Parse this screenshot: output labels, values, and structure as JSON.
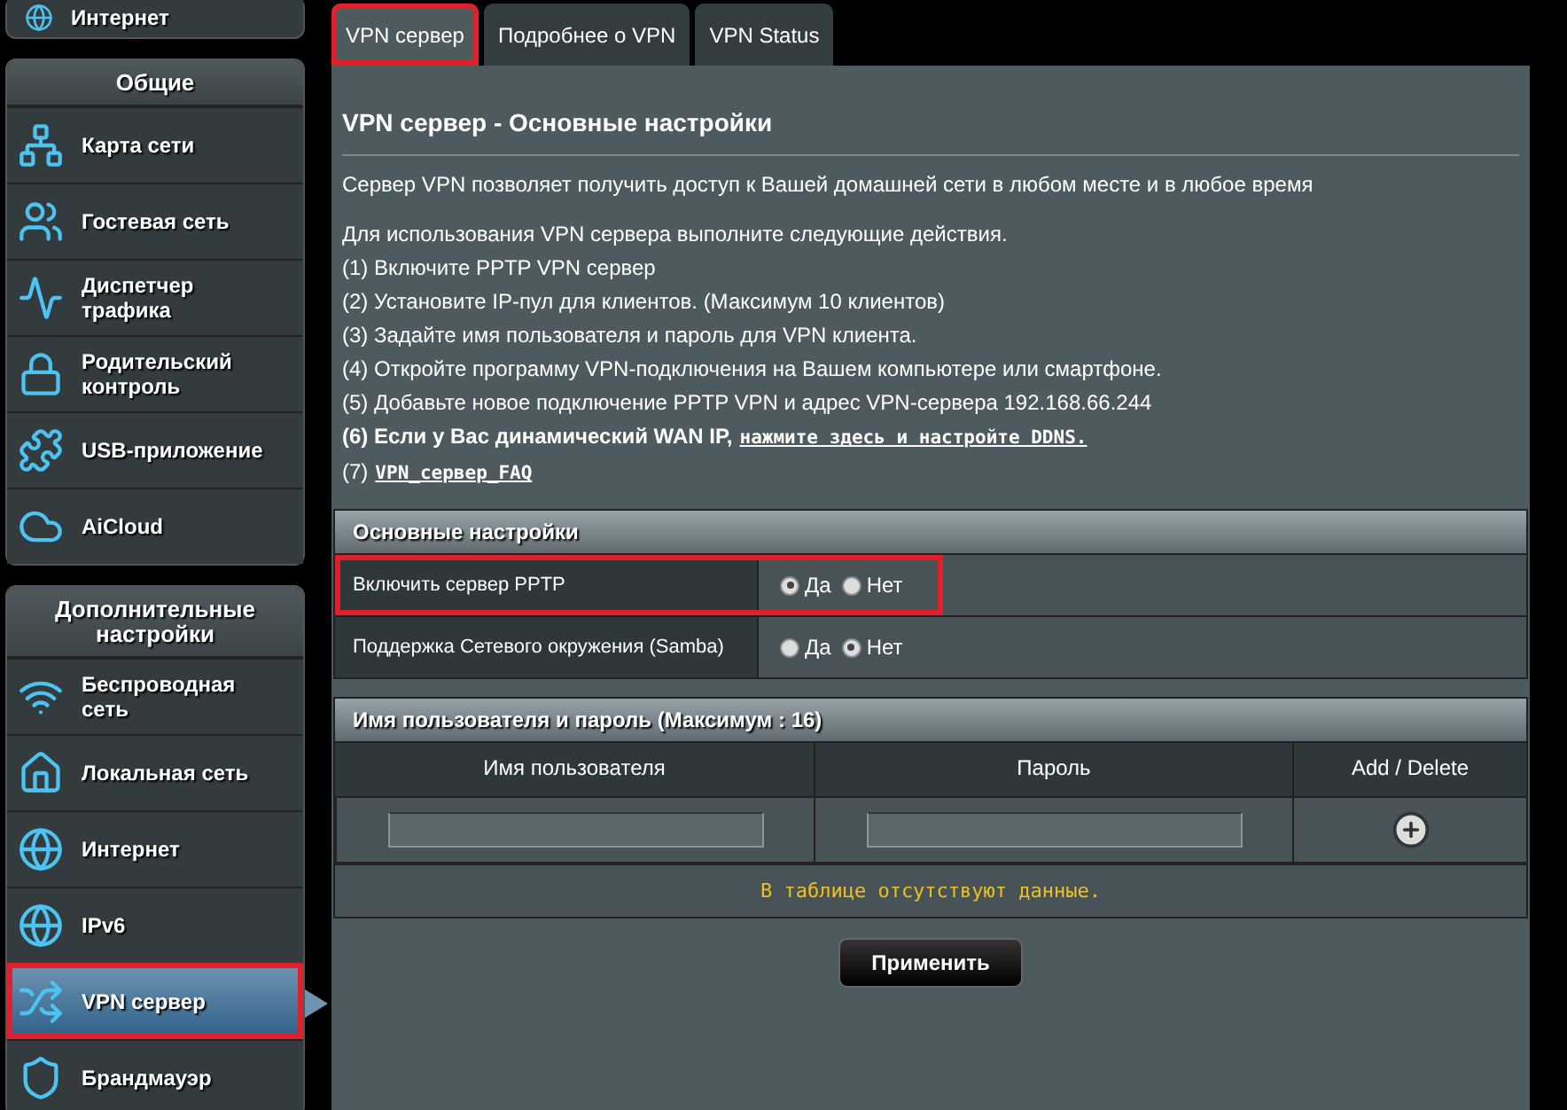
{
  "sidebar": {
    "top_item": {
      "label": "Интернет"
    },
    "groups": [
      {
        "title": "Общие",
        "items": [
          {
            "label": "Карта сети",
            "selected": false,
            "highlighted": false
          },
          {
            "label": "Гостевая сеть",
            "selected": false,
            "highlighted": false
          },
          {
            "label": "Диспетчер трафика",
            "selected": false,
            "highlighted": false
          },
          {
            "label": "Родительский контроль",
            "selected": false,
            "highlighted": false
          },
          {
            "label": "USB-приложение",
            "selected": false,
            "highlighted": false
          },
          {
            "label": "AiCloud",
            "selected": false,
            "highlighted": false
          }
        ]
      },
      {
        "title": "Дополнительные настройки",
        "items": [
          {
            "label": "Беспроводная сеть",
            "selected": false,
            "highlighted": false
          },
          {
            "label": "Локальная сеть",
            "selected": false,
            "highlighted": false
          },
          {
            "label": "Интернет",
            "selected": false,
            "highlighted": false
          },
          {
            "label": "IPv6",
            "selected": false,
            "highlighted": false
          },
          {
            "label": "VPN сервер",
            "selected": true,
            "highlighted": true
          },
          {
            "label": "Брандмауэр",
            "selected": false,
            "highlighted": false
          }
        ]
      }
    ]
  },
  "tabs": [
    {
      "label": "VPN сервер",
      "selected": true,
      "highlighted": true
    },
    {
      "label": "Подробнее о VPN",
      "selected": false,
      "highlighted": false
    },
    {
      "label": "VPN Status",
      "selected": false,
      "highlighted": false
    }
  ],
  "page": {
    "title": "VPN сервер - Основные настройки",
    "intro": "Сервер VPN позволяет получить доступ к Вашей домашней сети в любом месте и в любое время",
    "steps_intro": "Для использования VPN сервера выполните следующие действия.",
    "steps": [
      {
        "text": "(1) Включите PPTP VPN сервер",
        "bold": false
      },
      {
        "text": "(2) Установите IP-пул для клиентов. (Максимум 10 клиентов)",
        "bold": false
      },
      {
        "text": "(3) Задайте имя пользователя и пароль для VPN клиента.",
        "bold": false
      },
      {
        "text": "(4) Откройте программу VPN-подключения на Вашем компьютере или смартфоне.",
        "bold": false
      },
      {
        "text": "(5) Добавьте новое подключение PPTP VPN и адрес VPN-сервера 192.168.66.244",
        "bold": false
      },
      {
        "text": "(6) Если у Вас динамический WAN IP,",
        "bold": true,
        "link": "нажмите здесь и настройте DDNS."
      },
      {
        "text": "(7)",
        "bold": false,
        "link": "VPN_сервер_FAQ"
      }
    ]
  },
  "basic_settings": {
    "title": "Основные настройки",
    "rows": [
      {
        "label": "Включить сервер PPTP",
        "highlighted": true,
        "options": [
          {
            "label": "Да",
            "selected": true
          },
          {
            "label": "Нет",
            "selected": false
          }
        ]
      },
      {
        "label": "Поддержка Сетевого окружения (Samba)",
        "highlighted": false,
        "options": [
          {
            "label": "Да",
            "selected": false
          },
          {
            "label": "Нет",
            "selected": true
          }
        ]
      }
    ]
  },
  "users": {
    "title": "Имя пользователя и пароль (Максимум : 16)",
    "columns": [
      "Имя пользователя",
      "Пароль",
      "Add / Delete"
    ],
    "empty_message": "В таблице отсутствуют данные."
  },
  "apply_button": "Применить"
}
